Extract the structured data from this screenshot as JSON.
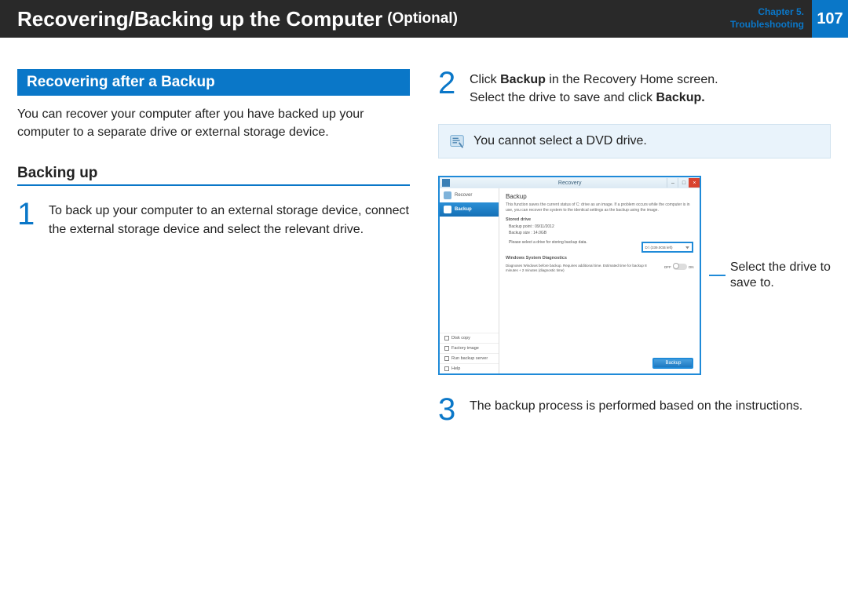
{
  "header": {
    "title": "Recovering/Backing up the Computer",
    "optional": "(Optional)",
    "chapter_line1": "Chapter 5.",
    "chapter_line2": "Troubleshooting",
    "page": "107"
  },
  "left": {
    "section_badge": "Recovering after a Backup",
    "intro": "You can recover your computer after you have backed up your computer to a separate drive or external storage device.",
    "subheading": "Backing up",
    "step1_num": "1",
    "step1_text": "To back up your computer to an external storage device, connect the external storage device and select the relevant drive."
  },
  "right": {
    "step2_num": "2",
    "step2_a": "Click ",
    "step2_b": "Backup",
    "step2_c": " in the Recovery Home screen.",
    "step2_d": "Select the drive to save and click ",
    "step2_e": "Backup.",
    "note": "You cannot select a DVD drive.",
    "callout": "Select the drive to save to.",
    "step3_num": "3",
    "step3_text": "The backup process is performed based on the instructions."
  },
  "app": {
    "title": "Recovery",
    "side_recover": "Recover",
    "side_backup": "Backup",
    "link_disk": "Disk copy",
    "link_factory": "Factory image",
    "link_server": "Run backup server",
    "link_help": "Help",
    "main_title": "Backup",
    "main_desc": "This function saves the current status of C: drive as an image. If a problem occurs while the computer is in use, you can recover the system to the identical settings as the backup using the image.",
    "stored_label": "Stored drive",
    "backup_point": "Backup point : 09/11/2012",
    "backup_size": "Backup size : 14.0GB",
    "select_prompt": "Please select a drive for storing backup data.",
    "drive_value": "D:\\ (339.0GB left)",
    "diag_label": "Windows System Diagnostics",
    "diag_text": "Diagnoses Windows before backup. Requires additional time. Estimated time for backup 8 minutes + 2 minutes (diagnostic time)",
    "toggle_off": "OFF",
    "toggle_on": "ON",
    "backup_btn": "Backup"
  }
}
